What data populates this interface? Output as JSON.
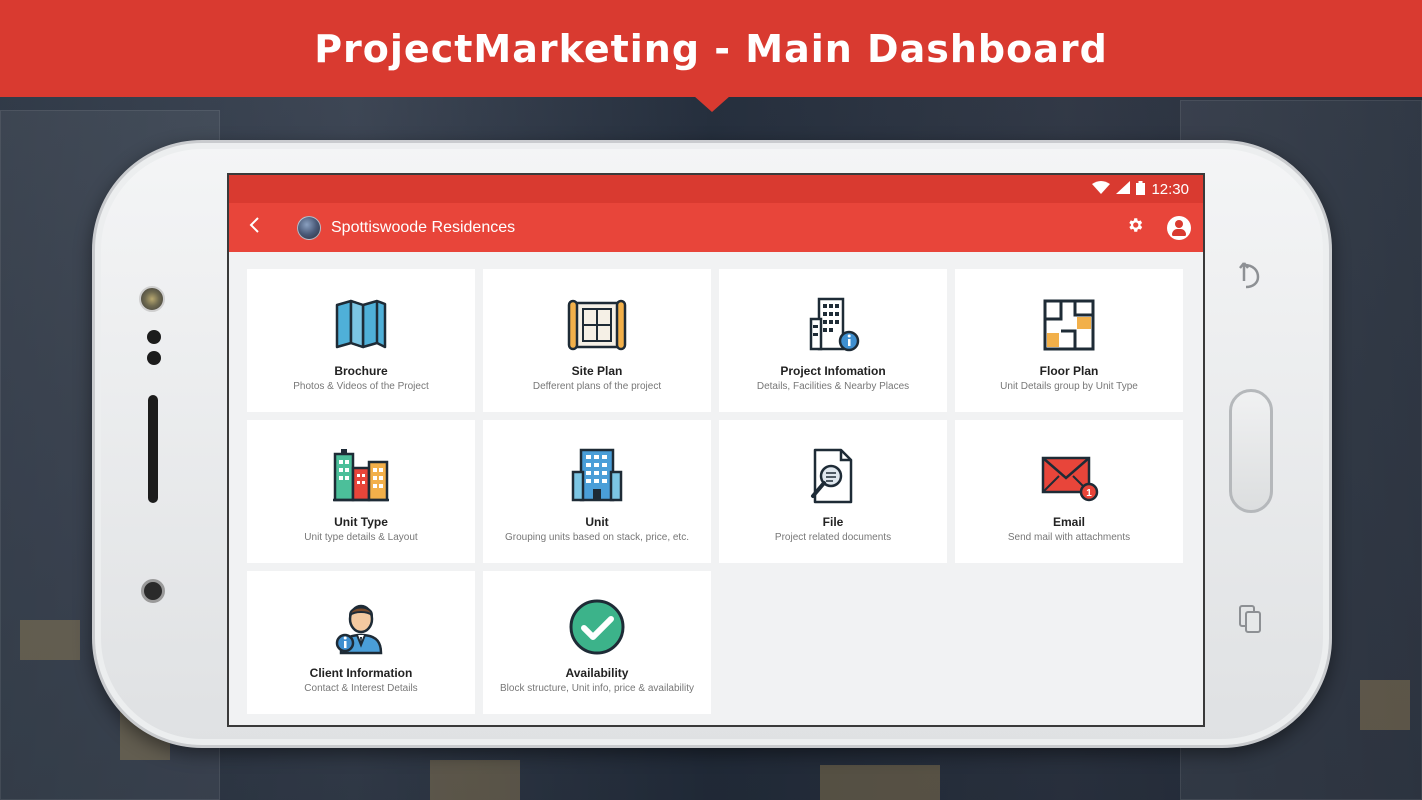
{
  "banner": {
    "title": "ProjectMarketing - Main Dashboard"
  },
  "status": {
    "time": "12:30"
  },
  "toolbar": {
    "title": "Spottiswoode Residences"
  },
  "tiles": [
    {
      "title": "Brochure",
      "subtitle": "Photos & Videos of the Project",
      "icon": "map-icon"
    },
    {
      "title": "Site Plan",
      "subtitle": "Defferent plans of the project",
      "icon": "blueprint-icon"
    },
    {
      "title": "Project Infomation",
      "subtitle": "Details, Facilities & Nearby Places",
      "icon": "building-info-icon"
    },
    {
      "title": "Floor Plan",
      "subtitle": "Unit Details group by Unit Type",
      "icon": "floor-plan-icon"
    },
    {
      "title": "Unit Type",
      "subtitle": "Unit type details & Layout",
      "icon": "city-buildings-icon"
    },
    {
      "title": "Unit",
      "subtitle": "Grouping units based on stack, price, etc.",
      "icon": "tower-icon"
    },
    {
      "title": "File",
      "subtitle": "Project related documents",
      "icon": "document-search-icon"
    },
    {
      "title": "Email",
      "subtitle": "Send mail with attachments",
      "icon": "envelope-icon"
    },
    {
      "title": "Client Information",
      "subtitle": "Contact & Interest Details",
      "icon": "client-icon"
    },
    {
      "title": "Availability",
      "subtitle": "Block structure, Unit info, price & availability",
      "icon": "check-circle-icon"
    }
  ],
  "colors": {
    "primary": "#e8453a",
    "banner": "#d93a30"
  }
}
